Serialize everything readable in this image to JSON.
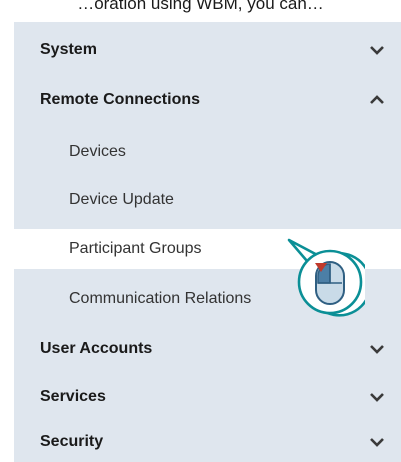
{
  "header": {
    "top_text": "…oration using WBM, you can…"
  },
  "menu": {
    "items": [
      {
        "label": "System",
        "expanded": false,
        "icon": "chevron-down-icon"
      },
      {
        "label": "Remote Connections",
        "expanded": true,
        "icon": "chevron-up-icon",
        "children": [
          {
            "label": "Devices"
          },
          {
            "label": "Device Update"
          },
          {
            "label": "Participant Groups",
            "selected": true
          },
          {
            "label": "Communication Relations"
          }
        ]
      },
      {
        "label": "User Accounts",
        "expanded": false,
        "icon": "chevron-down-icon"
      },
      {
        "label": "Services",
        "expanded": false,
        "icon": "chevron-down-icon"
      },
      {
        "label": "Security",
        "expanded": false,
        "icon": "chevron-down-icon"
      }
    ]
  },
  "colors": {
    "panel_bg": "#dfe6ee",
    "selected_bg": "#ffffff",
    "callout_teal": "#0b8f96",
    "mouse_blue": "#4c7fa6",
    "pointer_red": "#c0392b"
  },
  "cursor_icon": "mouse-left-click-icon"
}
